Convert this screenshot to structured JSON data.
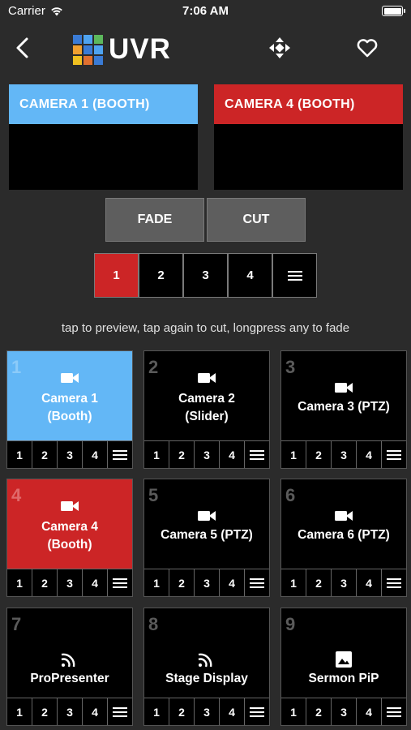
{
  "status": {
    "carrier": "Carrier",
    "time": "7:06 AM"
  },
  "nav": {
    "logo_text": "UVR"
  },
  "preview": {
    "label": "CAMERA 1 (BOOTH)",
    "color": "#63b7f6"
  },
  "program": {
    "label": "CAMERA 4 (BOOTH)",
    "color": "#cc2526"
  },
  "transitions": {
    "fade": "FADE",
    "cut": "CUT"
  },
  "main_keys": [
    "1",
    "2",
    "3",
    "4"
  ],
  "hint": "tap to preview, tap again to cut, longpress any to fade",
  "tile_keys": [
    "1",
    "2",
    "3",
    "4"
  ],
  "tiles": [
    {
      "num": "1",
      "label": "Camera 1\n(Booth)",
      "icon": "videocam-icon",
      "state": "preview"
    },
    {
      "num": "2",
      "label": "Camera 2\n(Slider)",
      "icon": "videocam-icon",
      "state": "idle"
    },
    {
      "num": "3",
      "label": "Camera 3 (PTZ)",
      "icon": "videocam-icon",
      "state": "idle"
    },
    {
      "num": "4",
      "label": "Camera 4\n(Booth)",
      "icon": "videocam-icon",
      "state": "program"
    },
    {
      "num": "5",
      "label": "Camera 5 (PTZ)",
      "icon": "videocam-icon",
      "state": "idle"
    },
    {
      "num": "6",
      "label": "Camera 6 (PTZ)",
      "icon": "videocam-icon",
      "state": "idle"
    },
    {
      "num": "7",
      "label": "ProPresenter",
      "icon": "signal-icon",
      "state": "idle"
    },
    {
      "num": "8",
      "label": "Stage Display",
      "icon": "signal-icon",
      "state": "idle"
    },
    {
      "num": "9",
      "label": "Sermon PiP",
      "icon": "image-icon",
      "state": "idle"
    }
  ],
  "colors": {
    "background": "#2b2b2b",
    "preview": "#63b7f6",
    "program": "#cc2526"
  }
}
